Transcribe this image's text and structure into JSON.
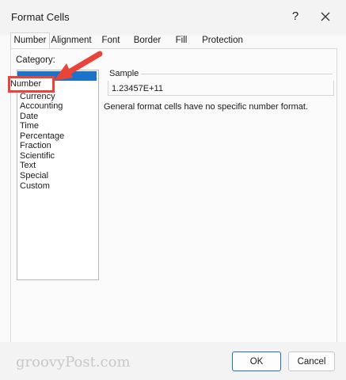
{
  "dialog": {
    "title": "Format Cells",
    "help_label": "?",
    "icons": {
      "close": "close-icon",
      "arrow": "red-callout-arrow"
    }
  },
  "tabs": [
    {
      "label": "Number",
      "active": true
    },
    {
      "label": "Alignment"
    },
    {
      "label": "Font"
    },
    {
      "label": "Border"
    },
    {
      "label": "Fill"
    },
    {
      "label": "Protection"
    }
  ],
  "category": {
    "label": "Category:",
    "items": [
      "Number",
      "Currency",
      "Accounting",
      "Date",
      "Time",
      "Percentage",
      "Fraction",
      "Scientific",
      "Text",
      "Special",
      "Custom"
    ],
    "highlighted": "Number"
  },
  "sample": {
    "label": "Sample",
    "value": "1.23457E+11"
  },
  "description": "General format cells have no specific number format.",
  "buttons": {
    "ok": "OK",
    "cancel": "Cancel"
  },
  "watermark": "groovyPost.com",
  "colors": {
    "selection": "#1a73c8",
    "callout": "#e8443a",
    "ok_border": "#1f6fc4"
  }
}
